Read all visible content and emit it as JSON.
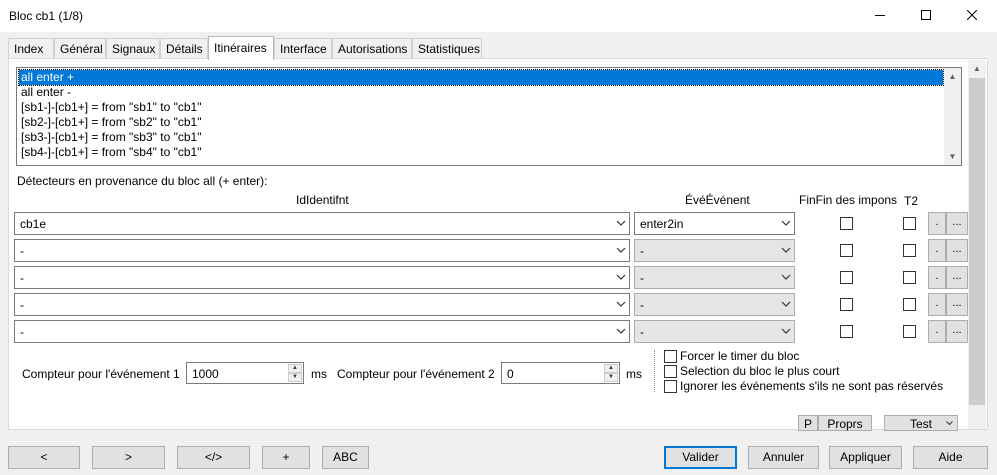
{
  "window": {
    "title": "Bloc cb1 (1/8)",
    "controls": [
      "minimize-icon",
      "maximize-icon",
      "close-icon"
    ]
  },
  "tabs": [
    "Index",
    "Général",
    "Signaux",
    "Détails",
    "Itinéraires",
    "Interface",
    "Autorisations",
    "Statistiques"
  ],
  "active_tab": "Itinéraires",
  "itineraries": [
    "all enter +",
    "all enter -",
    "[sb1-]-[cb1+] = from \"sb1\" to \"cb1\"",
    "[sb2-]-[cb1+] = from \"sb2\" to \"cb1\"",
    "[sb3-]-[cb1+] = from \"sb3\" to \"cb1\"",
    "[sb4-]-[cb1+] = from \"sb4\" to \"cb1\""
  ],
  "detectors": {
    "section_label": "Détecteurs en provenance du bloc all (+ enter):",
    "col_identifiant": "IdIdentifnt",
    "col_evenement": "ÉvéÉvénent",
    "col_fin": "FinFin des impons",
    "col_t2": "T2",
    "rows": [
      {
        "identifiant": "cb1e",
        "evenement": "enter2in"
      },
      {
        "identifiant": "-",
        "evenement": "-"
      },
      {
        "identifiant": "-",
        "evenement": "-"
      },
      {
        "identifiant": "-",
        "evenement": "-"
      },
      {
        "identifiant": "-",
        "evenement": "-"
      }
    ],
    "btn_small": ".",
    "btn_more": "..."
  },
  "counters": {
    "label1": "Compteur pour l'événement 1",
    "value1": "1000",
    "label2": "Compteur pour l'événement 2",
    "value2": "0",
    "unit": "ms"
  },
  "options": [
    "Forcer le timer du bloc",
    "Selection du bloc le plus court",
    "Ignorer les événements s'ils ne sont pas réservés"
  ],
  "mini_buttons": {
    "p": "P",
    "props": "Proprs",
    "test": "Test"
  },
  "bottom_buttons": {
    "prev": "<",
    "next": ">",
    "code": "</>",
    "plus": "+",
    "abc": "ABC",
    "valider": "Valider",
    "annuler": "Annuler",
    "appliquer": "Appliquer",
    "aide": "Aide"
  }
}
